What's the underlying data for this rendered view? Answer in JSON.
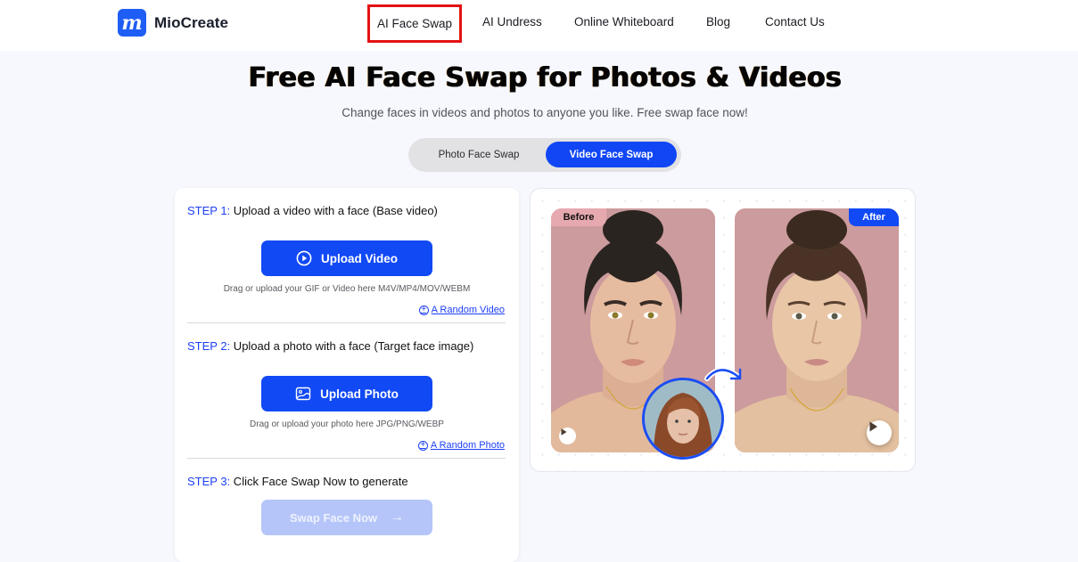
{
  "header": {
    "brand": "MioCreate",
    "logo_letter": "m",
    "nav": [
      {
        "label": "AI Face Swap",
        "active": true
      },
      {
        "label": "AI Undress"
      },
      {
        "label": "Online Whiteboard"
      },
      {
        "label": "Blog"
      },
      {
        "label": "Contact Us"
      }
    ]
  },
  "hero": {
    "title": "Free AI Face Swap for Photos & Videos",
    "subtitle": "Change faces in videos and photos to anyone you like. Free swap face now!",
    "modes": [
      {
        "label": "Photo Face Swap",
        "selected": false
      },
      {
        "label": "Video Face Swap",
        "selected": true
      }
    ]
  },
  "steps": {
    "step1": {
      "num": "STEP 1:",
      "text": " Upload a video with a face (Base video)",
      "button": "Upload Video",
      "button_icon": "play-circle-icon",
      "hint": "Drag or upload your GIF or Video here M4V/MP4/MOV/WEBM",
      "random_link": "A Random Video"
    },
    "step2": {
      "num": "STEP 2:",
      "text": " Upload a photo with a face (Target face image)",
      "button": "Upload Photo",
      "button_icon": "image-icon",
      "hint": "Drag or upload your photo here JPG/PNG/WEBP",
      "random_link": "A Random Photo"
    },
    "step3": {
      "num": "STEP 3:",
      "text": " Click Face Swap Now to generate",
      "button": "Swap Face Now",
      "button_arrow": "→",
      "enabled": false
    }
  },
  "preview": {
    "before_label": "Before",
    "after_label": "After",
    "plus_glyph": "+"
  },
  "colors": {
    "accent": "#1149f5",
    "step_blue": "#1d3ff5",
    "disabled_button": "#b5c5f9",
    "active_nav_outline": "#e41212",
    "page_bg": "#f6f8fd"
  }
}
